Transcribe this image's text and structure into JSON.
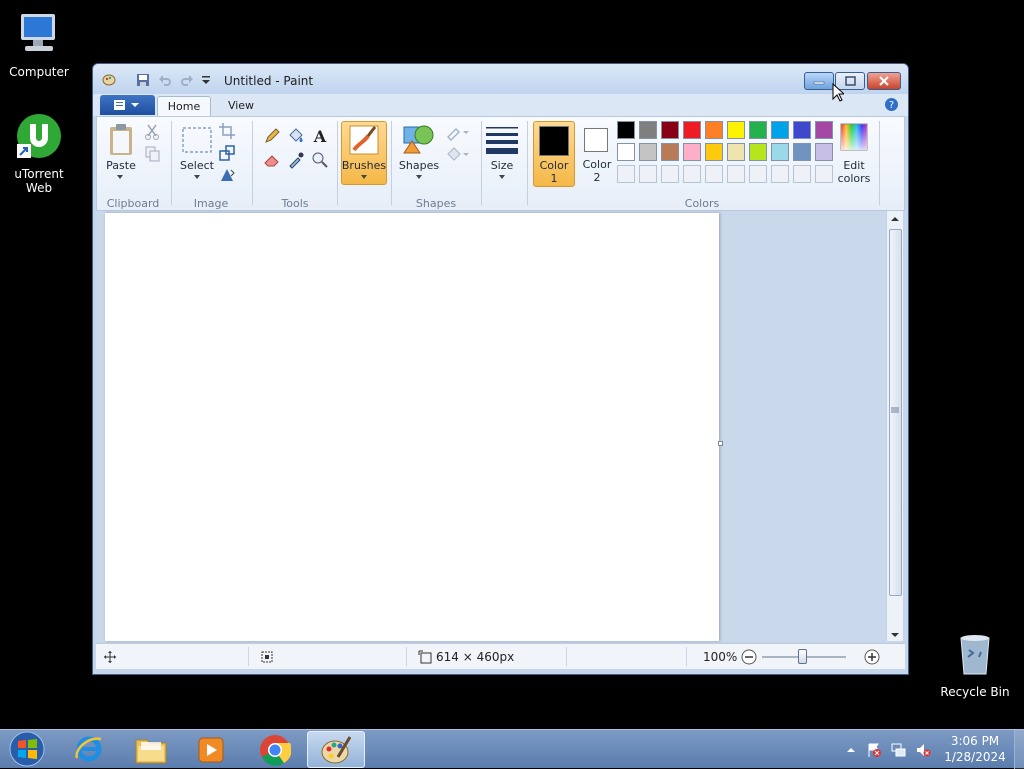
{
  "desktop": {
    "computer": "Computer",
    "utorrent": "uTorrent Web",
    "recycle": "Recycle Bin"
  },
  "window": {
    "title": "Untitled - Paint"
  },
  "tabs": {
    "home": "Home",
    "view": "View"
  },
  "ribbon": {
    "clipboard": {
      "label": "Clipboard",
      "paste": "Paste"
    },
    "image": {
      "label": "Image",
      "select": "Select"
    },
    "tools": {
      "label": "Tools"
    },
    "brushes": {
      "label": "Brushes"
    },
    "shapes": {
      "label": "Shapes",
      "shapes_btn": "Shapes"
    },
    "size": {
      "label": "Size"
    },
    "colors": {
      "label": "Colors",
      "color1": "Color",
      "color1_num": "1",
      "color2": "Color",
      "color2_num": "2",
      "edit": "Edit",
      "edit2": "colors",
      "row1": [
        "#000000",
        "#7f7f7f",
        "#880015",
        "#ed1c24",
        "#ff7f27",
        "#fff200",
        "#22b14c",
        "#00a2e8",
        "#3f48cc",
        "#a349a4"
      ],
      "row2": [
        "#ffffff",
        "#c3c3c3",
        "#b97a57",
        "#ffaec9",
        "#ffc90e",
        "#efe4b0",
        "#b5e61d",
        "#99d9ea",
        "#7092be",
        "#c8bfe7"
      ]
    }
  },
  "status": {
    "size": "614 × 460px",
    "zoom": "100%"
  },
  "taskbar": {
    "time": "3:06 PM",
    "date": "1/28/2024"
  }
}
